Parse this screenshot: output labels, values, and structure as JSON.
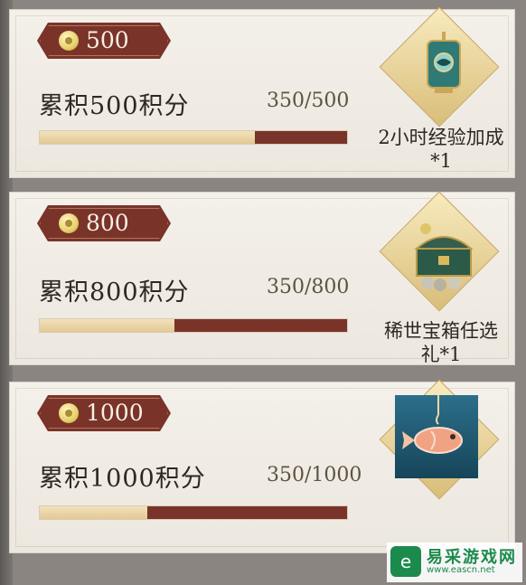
{
  "cards": [
    {
      "tag_value": "500",
      "title": "累积500积分",
      "score": "350/500",
      "progress": 0.7,
      "reward_label_line1": "2小时经验加成",
      "reward_label_line2": "*1",
      "reward_icon": "exp-scroll-icon"
    },
    {
      "tag_value": "800",
      "title": "累积800积分",
      "score": "350/800",
      "progress": 0.4375,
      "reward_label_line1": "稀世宝箱任选",
      "reward_label_line2": "礼*1",
      "reward_icon": "treasure-chest-icon"
    },
    {
      "tag_value": "1000",
      "title": "累积1000积分",
      "score": "350/1000",
      "progress": 0.35,
      "reward_label_line1": "",
      "reward_label_line2": "",
      "reward_icon": "fish-icon"
    }
  ],
  "watermark": {
    "logo_glyph": "e",
    "name": "易采游戏网",
    "url": "www.eascn.net"
  },
  "colors": {
    "accent": "#7a3329",
    "progress_fill": "#e8cf9c",
    "card_bg": "#f1ede6",
    "watermark": "#1c8a4d"
  }
}
